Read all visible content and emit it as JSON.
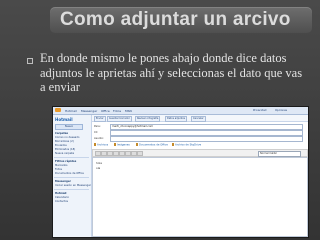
{
  "slide": {
    "title": "Como adjuntar un arcivo",
    "bullet": "En donde mismo le pones abajo donde dice datos adjuntos le aprietas ahí y seleccionas el dato que vas a enviar"
  },
  "mail": {
    "brand": "Hotmail",
    "top_menu": [
      "Hotmail",
      "Messenger",
      "Office",
      "Fotos",
      "MSN"
    ],
    "top_right": [
      "Privacidad",
      "Opciones"
    ],
    "toolbar": [
      "Enviar",
      "Guardar borrador",
      "Revisar ortografía",
      "Datos adjuntos",
      "Cancelar"
    ],
    "side_button": "Nuevo",
    "sidebar": {
      "sections": [
        {
          "title": "Carpetas",
          "items": [
            "Correo no deseado",
            "Borradores (2)",
            "Enviados",
            "Eliminados (18)",
            "Nueva carpeta"
          ]
        },
        {
          "title": "Filtros rápidos",
          "items": [
            "Marcados",
            "Fotos",
            "Documentos de Office"
          ]
        },
        {
          "title": "Messenger",
          "items": [
            "Iniciar sesión en Messenger"
          ]
        },
        {
          "title": "Hotmail",
          "items": [
            "Calendario",
            "Contactos"
          ]
        }
      ]
    },
    "fields": {
      "para_label": "Para:",
      "para_value": "marti_chocoappy@hotmail.com",
      "cc_label": "CC",
      "asunto_label": "Asunto:"
    },
    "attachments": [
      "Archivos",
      "Imágenes",
      "Documentos de Office",
      "Archivo de SkyDrive"
    ],
    "format": {
      "style_label": "Normal",
      "style_value": "Calibri"
    },
    "body_lines": [
      "hola",
      "ola"
    ]
  }
}
